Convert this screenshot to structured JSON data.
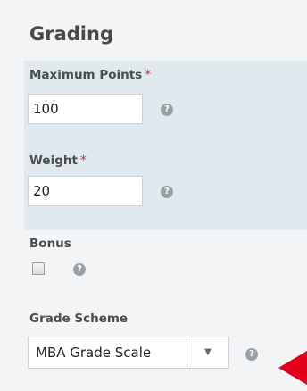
{
  "section": {
    "title": "Grading"
  },
  "maximum_points": {
    "label": "Maximum Points",
    "required_mark": "*",
    "value": "100"
  },
  "weight": {
    "label": "Weight",
    "required_mark": "*",
    "value": "20"
  },
  "bonus": {
    "label": "Bonus",
    "checked": false
  },
  "grade_scheme": {
    "label": "Grade Scheme",
    "selected": "MBA Grade Scale"
  },
  "icons": {
    "help": "question-circle-icon",
    "dropdown": "caret-down-icon",
    "pointer": "red-arrow-pointer"
  },
  "colors": {
    "required": "#d4283a",
    "highlight_bg": "#dfe9ee",
    "pointer": "#e2001a"
  }
}
